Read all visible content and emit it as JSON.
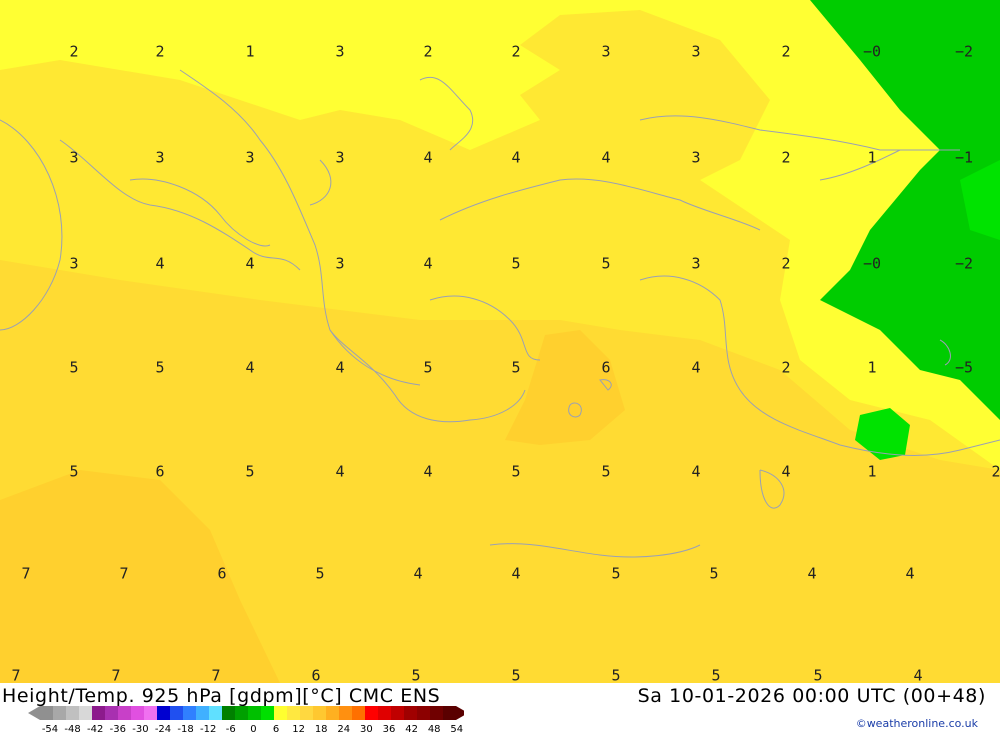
{
  "title_left": "Height/Temp. 925 hPa [gdpm][°C] CMC ENS",
  "title_right": "Sa 10-01-2026 00:00 UTC (00+48)",
  "credit": "©weatheronline.co.uk",
  "colors": {
    "zone_pale_yellow": "#ffff33",
    "zone_yellow": "#ffe833",
    "zone_gold": "#ffdb33",
    "zone_amber": "#ffd02e",
    "zone_green": "#00cc00",
    "zone_bright_green": "#00e300",
    "coastline": "#9aa0b4",
    "legend_colors": [
      "#909090",
      "#a8a8a8",
      "#c0c0c0",
      "#d8d8d8",
      "#8c1a8c",
      "#a830b0",
      "#c840c8",
      "#e050e0",
      "#f070f0",
      "#0000d0",
      "#2050f0",
      "#3080ff",
      "#40b0ff",
      "#60e0ff",
      "#008000",
      "#00a000",
      "#00c000",
      "#00e000",
      "#ffff30",
      "#ffe840",
      "#ffd840",
      "#ffc830",
      "#ffb020",
      "#ff9010",
      "#ff7000",
      "#ff0000",
      "#e00000",
      "#c00000",
      "#a00000",
      "#8c0000",
      "#700000",
      "#5a0000"
    ]
  },
  "legend_ticks": [
    "-54",
    "-48",
    "-42",
    "-36",
    "-30",
    "-24",
    "-18",
    "-12",
    "-6",
    "0",
    "6",
    "12",
    "18",
    "24",
    "30",
    "36",
    "42",
    "48",
    "54"
  ],
  "temperature_labels": [
    {
      "text": "2",
      "col": 0,
      "row": 0
    },
    {
      "text": "2",
      "col": 1,
      "row": 0
    },
    {
      "text": "1",
      "col": 2,
      "row": 0
    },
    {
      "text": "3",
      "col": 3,
      "row": 0
    },
    {
      "text": "2",
      "col": 4,
      "row": 0
    },
    {
      "text": "2",
      "col": 5,
      "row": 0
    },
    {
      "text": "3",
      "col": 6,
      "row": 0
    },
    {
      "text": "3",
      "col": 7,
      "row": 0
    },
    {
      "text": "2",
      "col": 8,
      "row": 0
    },
    {
      "text": "−0",
      "col": 9,
      "row": 0
    },
    {
      "text": "−2",
      "col": 10,
      "row": 0
    },
    {
      "text": "3",
      "col": 0,
      "row": 1
    },
    {
      "text": "3",
      "col": 1,
      "row": 1
    },
    {
      "text": "3",
      "col": 2,
      "row": 1
    },
    {
      "text": "3",
      "col": 3,
      "row": 1
    },
    {
      "text": "4",
      "col": 4,
      "row": 1
    },
    {
      "text": "4",
      "col": 5,
      "row": 1
    },
    {
      "text": "4",
      "col": 6,
      "row": 1
    },
    {
      "text": "3",
      "col": 7,
      "row": 1
    },
    {
      "text": "2",
      "col": 8,
      "row": 1
    },
    {
      "text": "1",
      "col": 9,
      "row": 1
    },
    {
      "text": "−1",
      "col": 10,
      "row": 1
    },
    {
      "text": "3",
      "col": 0,
      "row": 2
    },
    {
      "text": "4",
      "col": 1,
      "row": 2
    },
    {
      "text": "4",
      "col": 2,
      "row": 2
    },
    {
      "text": "3",
      "col": 3,
      "row": 2
    },
    {
      "text": "4",
      "col": 4,
      "row": 2
    },
    {
      "text": "5",
      "col": 5,
      "row": 2
    },
    {
      "text": "5",
      "col": 6,
      "row": 2
    },
    {
      "text": "3",
      "col": 7,
      "row": 2
    },
    {
      "text": "2",
      "col": 8,
      "row": 2
    },
    {
      "text": "−0",
      "col": 9,
      "row": 2
    },
    {
      "text": "−2",
      "col": 10,
      "row": 2
    },
    {
      "text": "5",
      "col": 0,
      "row": 3
    },
    {
      "text": "5",
      "col": 1,
      "row": 3
    },
    {
      "text": "4",
      "col": 2,
      "row": 3
    },
    {
      "text": "4",
      "col": 3,
      "row": 3
    },
    {
      "text": "5",
      "col": 4,
      "row": 3
    },
    {
      "text": "5",
      "col": 5,
      "row": 3
    },
    {
      "text": "6",
      "col": 6,
      "row": 3
    },
    {
      "text": "4",
      "col": 7,
      "row": 3
    },
    {
      "text": "2",
      "col": 8,
      "row": 3
    },
    {
      "text": "1",
      "col": 9,
      "row": 3
    },
    {
      "text": "−5",
      "col": 10,
      "row": 3
    },
    {
      "text": "5",
      "col": 0,
      "row": 4
    },
    {
      "text": "6",
      "col": 1,
      "row": 4
    },
    {
      "text": "5",
      "col": 2,
      "row": 4
    },
    {
      "text": "4",
      "col": 3,
      "row": 4
    },
    {
      "text": "4",
      "col": 4,
      "row": 4
    },
    {
      "text": "5",
      "col": 5,
      "row": 4
    },
    {
      "text": "5",
      "col": 6,
      "row": 4
    },
    {
      "text": "4",
      "col": 7,
      "row": 4
    },
    {
      "text": "4",
      "col": 8,
      "row": 4
    },
    {
      "text": "1",
      "col": 9,
      "row": 4
    },
    {
      "text": "2",
      "col": 10,
      "row": 4
    },
    {
      "text": "7",
      "col": 0,
      "row": 5
    },
    {
      "text": "7",
      "col": 1,
      "row": 5
    },
    {
      "text": "6",
      "col": 2,
      "row": 5
    },
    {
      "text": "5",
      "col": 3,
      "row": 5
    },
    {
      "text": "4",
      "col": 4,
      "row": 5
    },
    {
      "text": "4",
      "col": 5,
      "row": 5
    },
    {
      "text": "5",
      "col": 6,
      "row": 5
    },
    {
      "text": "5",
      "col": 7,
      "row": 5
    },
    {
      "text": "4",
      "col": 8,
      "row": 5
    },
    {
      "text": "4",
      "col": 9,
      "row": 5
    },
    {
      "text": "7",
      "col": 0,
      "row": 6
    },
    {
      "text": "7",
      "col": 1,
      "row": 6
    },
    {
      "text": "7",
      "col": 2,
      "row": 6
    },
    {
      "text": "6",
      "col": 3,
      "row": 6
    },
    {
      "text": "5",
      "col": 4,
      "row": 6
    },
    {
      "text": "5",
      "col": 5,
      "row": 6
    },
    {
      "text": "5",
      "col": 6,
      "row": 6
    },
    {
      "text": "5",
      "col": 7,
      "row": 6
    },
    {
      "text": "5",
      "col": 8,
      "row": 6
    },
    {
      "text": "4",
      "col": 9,
      "row": 6
    }
  ]
}
